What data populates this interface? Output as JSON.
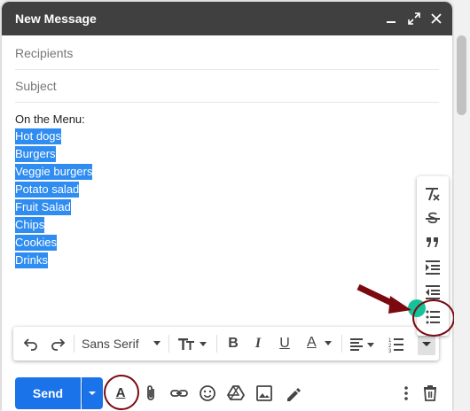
{
  "window": {
    "title": "New Message",
    "controls": [
      "minimize-icon",
      "expand-icon",
      "close-icon"
    ]
  },
  "fields": {
    "recipients_placeholder": "Recipients",
    "subject_placeholder": "Subject"
  },
  "body": {
    "intro": "On the Menu:",
    "items": [
      "Hot dogs",
      "Burgers",
      "Veggie burgers",
      "Potato salad",
      "Fruit Salad",
      "Chips",
      "Cookies",
      "Drinks"
    ]
  },
  "formatting_toolbar": {
    "font_family": "Sans Serif",
    "buttons": [
      "undo-icon",
      "redo-icon",
      "font-family-select",
      "text-size-icon",
      "bold-icon",
      "italic-icon",
      "underline-icon",
      "text-color-icon",
      "align-icon",
      "numbered-list-icon",
      "more-formatting-icon"
    ],
    "bold_glyph": "B",
    "italic_glyph": "I",
    "underline_glyph": "U",
    "text_color_glyph": "A"
  },
  "more_formatting_menu": [
    "remove-formatting-icon",
    "strikethrough-icon",
    "quote-icon",
    "indent-more-icon",
    "indent-less-icon",
    "bulleted-list-icon"
  ],
  "bottom_bar": {
    "send_label": "Send",
    "formatting_toggle_glyph": "A",
    "icons": [
      "formatting-options-icon",
      "attach-icon",
      "link-icon",
      "emoji-icon",
      "drive-icon",
      "photo-icon",
      "signature-icon",
      "more-options-icon",
      "discard-icon"
    ]
  },
  "colors": {
    "titlebar": "#404040",
    "selection": "#2f8cf0",
    "send": "#1a73e8",
    "annotation": "#7a0a10",
    "grammarly": "#15c39a"
  }
}
